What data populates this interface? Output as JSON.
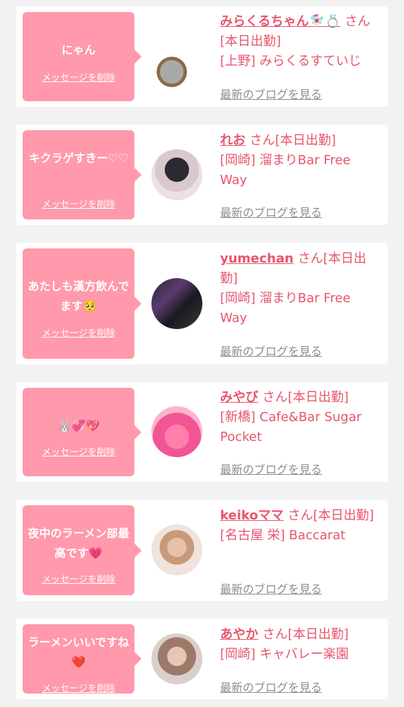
{
  "delete_label": "メッセージを削除",
  "blog_label": "最新のブログを見る",
  "san": "さん",
  "items": [
    {
      "message": "にゃん",
      "name": "みらくるちゃん🧚🏻‍♀️💍",
      "status": "[本日出勤]",
      "area": "[上野]",
      "shop": "みらくるすていじ",
      "avatar": "cat-avatar"
    },
    {
      "message": "キクラゲすきー♡♡",
      "name": "れお",
      "status": "[本日出勤]",
      "area": "[岡崎]",
      "shop": "溜まりBar Free Way",
      "avatar": "profile-avatar"
    },
    {
      "message": "あたしも漢方飲んでます🥺",
      "name": "yumechan",
      "status": "[本日出勤]",
      "area": "[岡崎]",
      "shop": "溜まりBar Free Way",
      "avatar": "profile-avatar"
    },
    {
      "message": "🐰💞💖",
      "name": "みやび",
      "status": "[本日出勤]",
      "area": "[新橋]",
      "shop": "Cafe&Bar Sugar Pocket",
      "avatar": "profile-avatar"
    },
    {
      "message": "夜中のラーメン部最高です💗",
      "name": "keikoママ",
      "status": "[本日出勤]",
      "area": "[名古屋 栄]",
      "shop": "Baccarat",
      "avatar": "profile-avatar"
    },
    {
      "message": "ラーメンいいですね❤️",
      "name": "あやか",
      "status": "[本日出勤]",
      "area": "[岡崎]",
      "shop": "キャバレー楽園",
      "avatar": "profile-avatar"
    }
  ]
}
